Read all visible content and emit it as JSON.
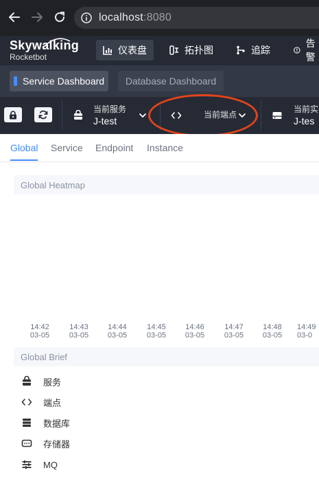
{
  "browser": {
    "url_host": "localhost",
    "url_port": ":8080"
  },
  "app": {
    "logo_name": "Skywalking",
    "logo_sub": "Rocketbot",
    "nav": [
      {
        "label": "仪表盘",
        "icon": "dashboard-icon",
        "active": true
      },
      {
        "label": "拓扑图",
        "icon": "topology-icon"
      },
      {
        "label": "追踪",
        "icon": "trace-icon"
      },
      {
        "label": "告警",
        "icon": "alarm-icon"
      }
    ]
  },
  "dashboards": {
    "active": "Service Dashboard",
    "inactive": "Database Dashboard"
  },
  "toolbar": {
    "service": {
      "label": "当前服务",
      "value": "J-test"
    },
    "endpoint": {
      "label": "当前端点",
      "value": ""
    },
    "instance": {
      "label": "当前实",
      "value": "J-tes"
    }
  },
  "tabs": [
    "Global",
    "Service",
    "Endpoint",
    "Instance"
  ],
  "heatmap": {
    "title": "Global Heatmap",
    "ticks": [
      {
        "time": "14:42",
        "date": "03-05"
      },
      {
        "time": "14:43",
        "date": "03-05"
      },
      {
        "time": "14:44",
        "date": "03-05"
      },
      {
        "time": "14:45",
        "date": "03-05"
      },
      {
        "time": "14:46",
        "date": "03-05"
      },
      {
        "time": "14:47",
        "date": "03-05"
      },
      {
        "time": "14:48",
        "date": "03-05"
      },
      {
        "time": "14:49",
        "date": "03-0"
      }
    ]
  },
  "brief": {
    "title": "Global Brief",
    "items": [
      {
        "label": "服务",
        "icon": "service-icon"
      },
      {
        "label": "端点",
        "icon": "code-icon"
      },
      {
        "label": "数据库",
        "icon": "database-icon"
      },
      {
        "label": "存储器",
        "icon": "storage-icon"
      },
      {
        "label": "MQ",
        "icon": "mq-icon"
      }
    ]
  },
  "colors": {
    "accent": "#448dfe",
    "header_bg": "#262a35",
    "highlight_ellipse": "#e2441b"
  }
}
